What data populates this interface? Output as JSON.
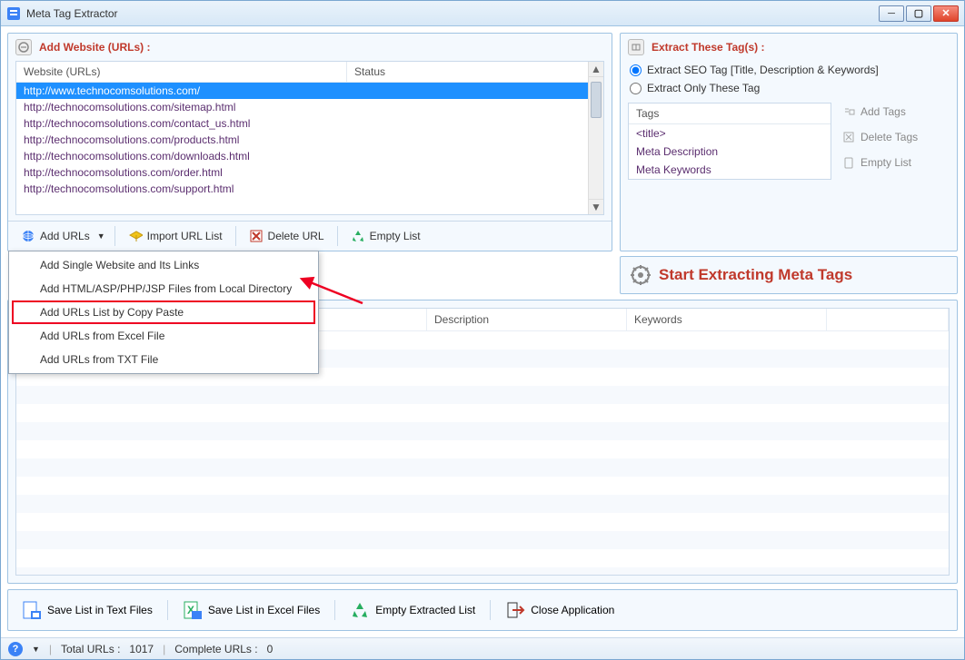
{
  "window": {
    "title": "Meta Tag Extractor"
  },
  "left_panel": {
    "header": "Add Website (URLs) :",
    "columns": [
      "Website (URLs)",
      "Status"
    ],
    "rows": [
      {
        "url": "http://www.technocomsolutions.com/",
        "selected": true
      },
      {
        "url": "http://technocomsolutions.com/sitemap.html"
      },
      {
        "url": "http://technocomsolutions.com/contact_us.html"
      },
      {
        "url": "http://technocomsolutions.com/products.html"
      },
      {
        "url": "http://technocomsolutions.com/downloads.html"
      },
      {
        "url": "http://technocomsolutions.com/order.html"
      },
      {
        "url": "http://technocomsolutions.com/support.html"
      }
    ],
    "toolbar": {
      "add_urls": "Add URLs",
      "import_url_list": "Import URL List",
      "delete_url": "Delete URL",
      "empty_list": "Empty List"
    },
    "dropdown_items": [
      "Add Single Website and Its Links",
      "Add HTML/ASP/PHP/JSP Files from Local Directory",
      "Add URLs List by Copy Paste",
      "Add URLs from Excel File",
      "Add URLs from TXT File"
    ],
    "highlight_index": 2
  },
  "right_panel": {
    "header": "Extract These Tag(s) :",
    "radio1": "Extract SEO Tag [Title, Description & Keywords]",
    "radio2": "Extract Only These Tag",
    "tag_col": "Tags",
    "tags": [
      "<title>",
      "Meta Description",
      "Meta Keywords"
    ],
    "buttons": {
      "add": "Add Tags",
      "delete": "Delete Tags",
      "empty": "Empty List"
    }
  },
  "extract_bar": "Start Extracting Meta Tags",
  "results": {
    "columns": {
      "desc": "Description",
      "keywords": "Keywords"
    }
  },
  "bottom": {
    "save_txt": "Save List in Text Files",
    "save_xls": "Save List in Excel Files",
    "empty": "Empty Extracted List",
    "close": "Close Application"
  },
  "status": {
    "total_label": "Total URLs :",
    "total_value": "1017",
    "complete_label": "Complete URLs :",
    "complete_value": "0"
  }
}
